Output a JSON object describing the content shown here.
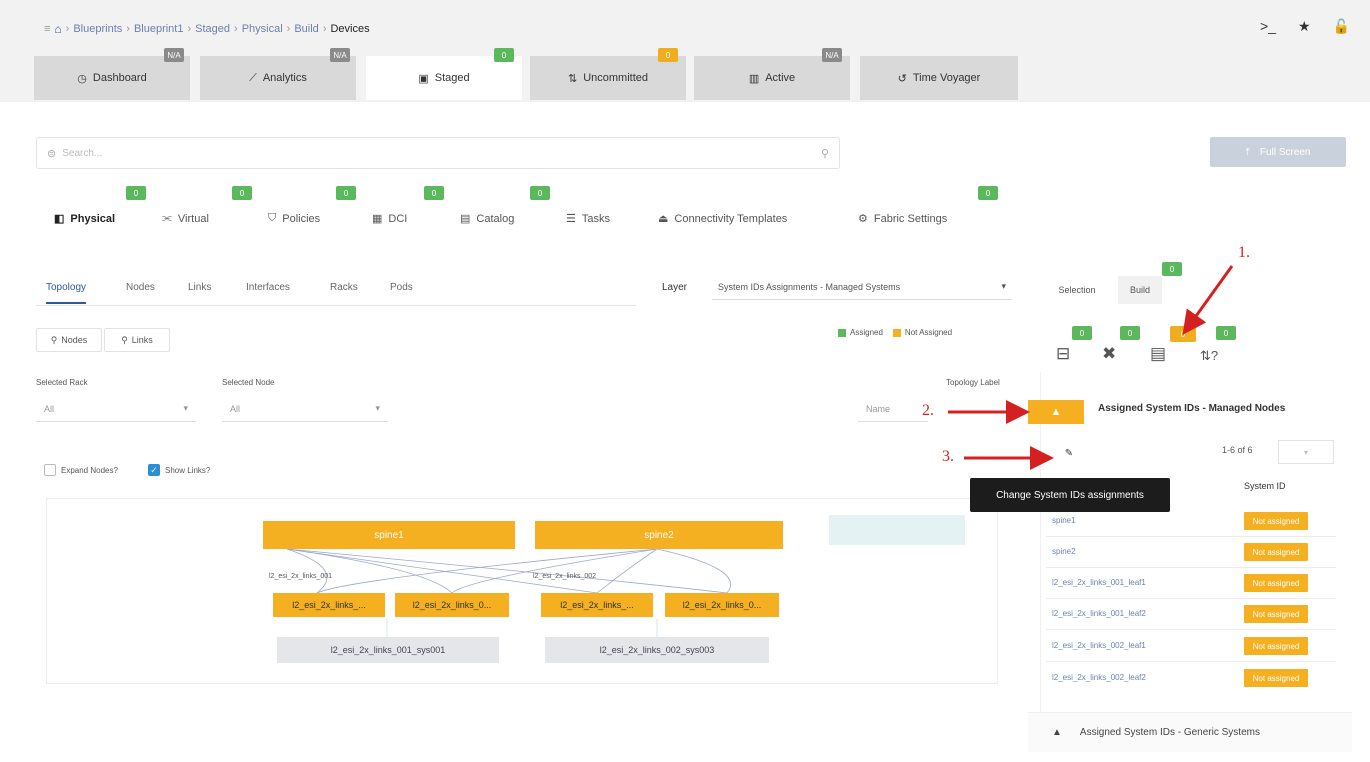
{
  "breadcrumb": {
    "items": [
      "Blueprints",
      "Blueprint1",
      "Staged",
      "Physical",
      "Build"
    ],
    "current": "Devices"
  },
  "top_icons": [
    "terminal-icon",
    "star-icon",
    "unlock-icon"
  ],
  "main_tabs": [
    {
      "label": "Dashboard",
      "badge": "N/A",
      "badge_color": "gray"
    },
    {
      "label": "Analytics",
      "badge": "N/A",
      "badge_color": "gray"
    },
    {
      "label": "Staged",
      "badge": "0",
      "badge_color": "green"
    },
    {
      "label": "Uncommitted",
      "badge": "0",
      "badge_color": "orange"
    },
    {
      "label": "Active",
      "badge": "N/A",
      "badge_color": "gray"
    },
    {
      "label": "Time Voyager"
    }
  ],
  "search": {
    "placeholder": "Search..."
  },
  "commit_button": {
    "label": "Full Screen"
  },
  "sub_nav": [
    {
      "label": "Physical",
      "badge": "0"
    },
    {
      "label": "Virtual",
      "badge": "0"
    },
    {
      "label": "Policies",
      "badge": "0"
    },
    {
      "label": "DCI",
      "badge": "0"
    },
    {
      "label": "Catalog",
      "badge": "0"
    },
    {
      "label": "Tasks"
    },
    {
      "label": "Connectivity Templates"
    },
    {
      "label": "Fabric Settings",
      "badge": "0"
    }
  ],
  "secondary_tabs": [
    "Topology",
    "Nodes",
    "Links",
    "Interfaces",
    "Racks",
    "Pods"
  ],
  "layer": {
    "label": "Layer",
    "value": "System IDs Assignments - Managed Systems"
  },
  "legend": {
    "assigned": "Assigned",
    "not_assigned": "Not Assigned"
  },
  "node_buttons": {
    "nodes": "Nodes",
    "links": "Links"
  },
  "selected_rack": {
    "label": "Selected Rack",
    "value": "All"
  },
  "selected_node": {
    "label": "Selected Node",
    "value": "All"
  },
  "topology_label": {
    "label": "Topology Label",
    "value": "Name"
  },
  "checkboxes": {
    "expand": "Expand Nodes?",
    "show_links": "Show Links?"
  },
  "topology": {
    "spines": [
      "spine1",
      "spine2"
    ],
    "leaves": [
      "l2_esi_2x_links_...",
      "l2_esi_2x_links_0...",
      "l2_esi_2x_links_...",
      "l2_esi_2x_links_0..."
    ],
    "link_labels": [
      "l2_esi_2x_links_001",
      "l2_esi_2x_links_002"
    ],
    "groups": [
      "l2_esi_2x_links_001_sys001",
      "l2_esi_2x_links_002_sys003"
    ]
  },
  "right_panel": {
    "tabs": [
      "Selection",
      "Build"
    ],
    "tab_badge": "0",
    "tool_badges": [
      "0",
      "0",
      "0",
      "0"
    ],
    "section1_title": "Assigned System IDs - Managed Nodes",
    "pager": "1-6 of 6",
    "tooltip": "Change System IDs assignments",
    "column_header": "System ID",
    "rows": [
      {
        "name": "spine1",
        "status": "Not assigned"
      },
      {
        "name": "spine2",
        "status": "Not assigned"
      },
      {
        "name": "l2_esi_2x_links_001_leaf1",
        "status": "Not assigned"
      },
      {
        "name": "l2_esi_2x_links_001_leaf2",
        "status": "Not assigned"
      },
      {
        "name": "l2_esi_2x_links_002_leaf1",
        "status": "Not assigned"
      },
      {
        "name": "l2_esi_2x_links_002_leaf2",
        "status": "Not assigned"
      }
    ],
    "section2_title": "Assigned System IDs - Generic Systems"
  },
  "annotations": [
    "1.",
    "2.",
    "3."
  ],
  "colors": {
    "accent_orange": "#f4b020",
    "badge_green": "#5cb85c",
    "badge_gray": "#8a8a8a",
    "arrow_red": "#d42020",
    "link_blue": "#2d5a9b"
  }
}
